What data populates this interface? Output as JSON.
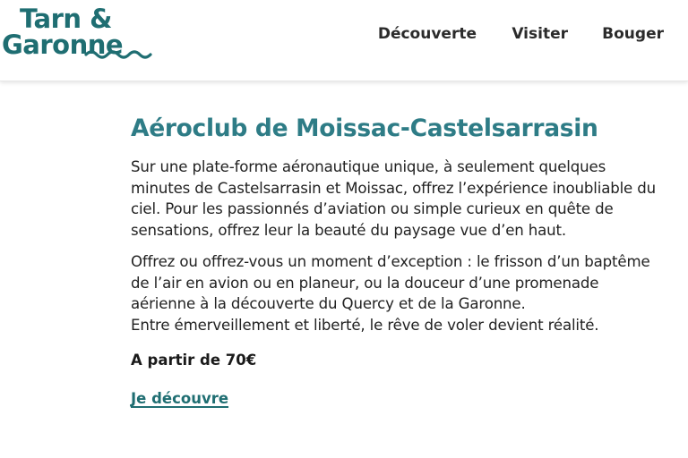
{
  "colors": {
    "brand": "#1f6e72",
    "title": "#2e7c86",
    "text": "#222222",
    "nav_text": "#2b2b2b"
  },
  "header": {
    "logo": {
      "line1": "Tarn &",
      "line2": "Garonne",
      "icon": "wave-logo-mark"
    },
    "nav": [
      {
        "label": "Découverte"
      },
      {
        "label": "Visiter"
      },
      {
        "label": "Bouger"
      }
    ]
  },
  "main": {
    "title": "Aéroclub de Moissac-Castelsarrasin",
    "paragraph1": [
      "Sur une plate-forme aéronautique unique, à seulement quelques",
      "minutes de Castelsarrasin et Moissac, offrez l’expérience inoubliable du",
      "ciel. Pour les passionnés d’aviation ou simple curieux en quête de",
      "sensations, offrez leur la beauté du paysage vue d’en haut."
    ],
    "paragraph2": [
      "Offrez ou offrez-vous un moment d’exception : le frisson d’un baptême",
      "de l’air en avion ou en planeur, ou la douceur d’une promenade",
      "aérienne à la découverte du Quercy et de la Garonne.",
      "Entre émerveillement et liberté, le rêve de voler devient réalité."
    ],
    "price": "A partir de 70€",
    "cta_label": "Je découvre"
  }
}
